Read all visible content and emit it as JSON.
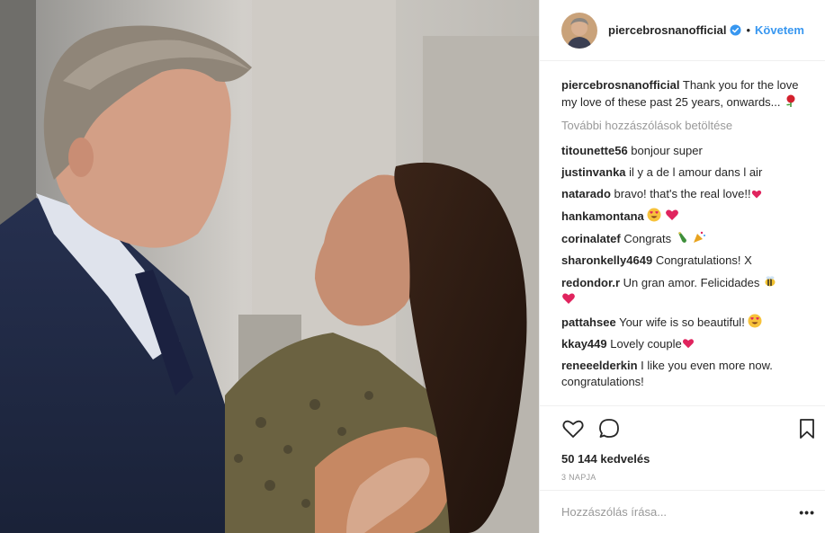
{
  "post": {
    "username": "piercebrosnanofficial",
    "separator": "•",
    "follow_label": "Követem",
    "caption_user": "piercebrosnanofficial",
    "caption_text": "Thank you for the love my love of these past 25 years, onwards...",
    "load_more": "További hozzászólások betöltése",
    "likes": "50 144 kedvelés",
    "age": "3 NAPJA",
    "comment_placeholder": "Hozzászólás írása...",
    "more_label": "•••"
  },
  "comments": [
    {
      "user": "titounette56",
      "text": "bonjour super"
    },
    {
      "user": "justinvanka",
      "text": "il y a de l amour dans l air"
    },
    {
      "user": "natarado",
      "text": "bravo! that's the real love!!"
    },
    {
      "user": "hankamontana",
      "text": ""
    },
    {
      "user": "corinalatef",
      "text": "Congrats"
    },
    {
      "user": "sharonkelly4649",
      "text": "Congratulations! X"
    },
    {
      "user": "redondor.r",
      "text": "Un gran amor. Felicidades"
    },
    {
      "user": "pattahsee",
      "text": "Your wife is so beautiful!"
    },
    {
      "user": "kkay449",
      "text": "Lovely couple"
    },
    {
      "user": "reneeelderkin",
      "text": "I like you even more now. congratulations!"
    }
  ],
  "icons": {
    "verified": "verified-badge-icon",
    "like": "heart-outline-icon",
    "comment": "speech-bubble-icon",
    "save": "bookmark-icon",
    "emoji_rose": "rose-emoji",
    "emoji_heart": "red-heart-emoji",
    "emoji_heart_eyes": "heart-eyes-emoji",
    "emoji_bottle": "bottle-emoji",
    "emoji_party": "party-popper-emoji",
    "emoji_bee": "bee-emoji"
  },
  "colors": {
    "link_blue": "#3897f0",
    "muted": "#999999",
    "text": "#262626",
    "border": "#efefef"
  }
}
